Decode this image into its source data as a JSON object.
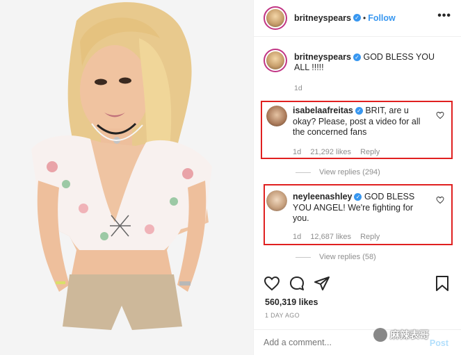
{
  "post": {
    "author": "britneyspears",
    "follow_label": "Follow",
    "more_label": "•••",
    "caption_text": "GOD BLESS YOU ALL !!!!!",
    "caption_time": "1d",
    "likes": "560,319 likes",
    "time_ago": "1 DAY AGO",
    "add_comment_placeholder": "Add a comment...",
    "post_label": "Post"
  },
  "comments": [
    {
      "username": "isabelaafreitas",
      "text": "BRIT, are u okay? Please, post a video for all the concerned fans",
      "time": "1d",
      "likes": "21,292 likes",
      "reply_label": "Reply",
      "view_replies": "View replies (294)"
    },
    {
      "username": "neyleenashley",
      "text": "GOD BLESS YOU ANGEL! We're fighting for you.",
      "time": "1d",
      "likes": "12,687 likes",
      "reply_label": "Reply",
      "view_replies": "View replies (58)"
    }
  ],
  "watermark": {
    "text": "麻辣表哥"
  },
  "colors": {
    "verified_blue": "#3897f0",
    "follow_blue": "#3897f0",
    "highlight_red": "#e02020",
    "secondary_text": "#8e8e8e",
    "primary_text": "#262626"
  },
  "icons": {
    "verified": "verified-badge-icon",
    "heart": "heart-icon",
    "comment": "comment-icon",
    "share": "share-icon",
    "save": "bookmark-icon",
    "more": "more-options-icon"
  }
}
